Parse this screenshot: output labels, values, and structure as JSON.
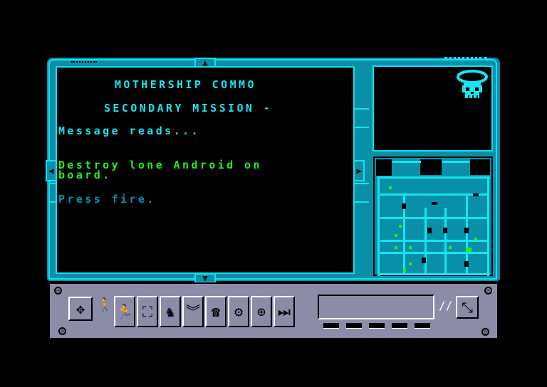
{
  "message_screen": {
    "title": "MOTHERSHIP COMMO",
    "subtitle": "SECONDARY MISSION -",
    "intro": "Message reads...",
    "body_line1": "Destroy lone Android on",
    "body_line2": "board.",
    "prompt": "Press fire."
  },
  "scroll": {
    "up_icon": "▲",
    "down_icon": "▼",
    "left_icon": "◀",
    "right_icon": "▶"
  },
  "portrait": {
    "icon": "skull-with-halo"
  },
  "toolbar": {
    "buttons": [
      {
        "name": "move-cursor",
        "glyph": "✥"
      },
      {
        "name": "walk",
        "glyph": "🚶"
      },
      {
        "name": "shoot",
        "glyph": "🏃"
      },
      {
        "name": "inspect",
        "glyph": "⛶"
      },
      {
        "name": "rank",
        "glyph": "︾"
      },
      {
        "name": "communicate",
        "glyph": "☎"
      },
      {
        "name": "disk-options",
        "glyph": "⚙"
      },
      {
        "name": "target",
        "glyph": "⊕"
      },
      {
        "name": "end-turn",
        "glyph": "⏭"
      }
    ],
    "zoom_glyph": "⤡",
    "led_count": 5
  },
  "colors": {
    "frame": "#0a8fa8",
    "frame_highlight": "#14e6f0",
    "text_cyan": "#14e6f0",
    "text_green": "#1ef01e",
    "panel_grey": "#8c8ca8"
  }
}
